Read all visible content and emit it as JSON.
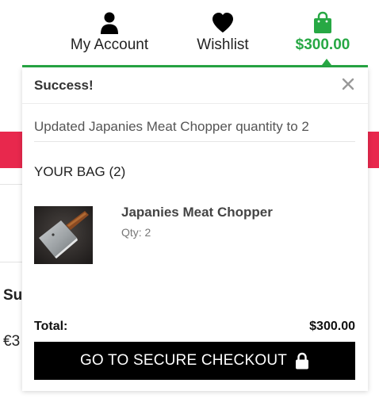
{
  "header": {
    "account": {
      "label": "My Account",
      "icon": "user-icon"
    },
    "wishlist": {
      "label": "Wishlist",
      "icon": "heart-icon"
    },
    "bag": {
      "label": "$300.00",
      "icon": "shopping-bag-icon"
    }
  },
  "background": {
    "subtotal_fragment": "Sul",
    "price_fragment": "€3"
  },
  "popup": {
    "title": "Success!",
    "close_icon": "close-icon",
    "message": "Updated Japanies Meat Chopper quantity to 2",
    "bag_heading": "YOUR BAG (2)",
    "items": [
      {
        "name": "Japanies Meat Chopper",
        "qty": "Qty: 2",
        "image": "meat-chopper-knife-photo"
      }
    ],
    "total_label": "Total:",
    "total_value": "$300.00",
    "checkout_label": "GO TO SECURE CHECKOUT",
    "checkout_icon": "lock-icon"
  },
  "colors": {
    "accent_green": "#27a844",
    "brand_red": "#e8284d",
    "button_black": "#000000"
  }
}
